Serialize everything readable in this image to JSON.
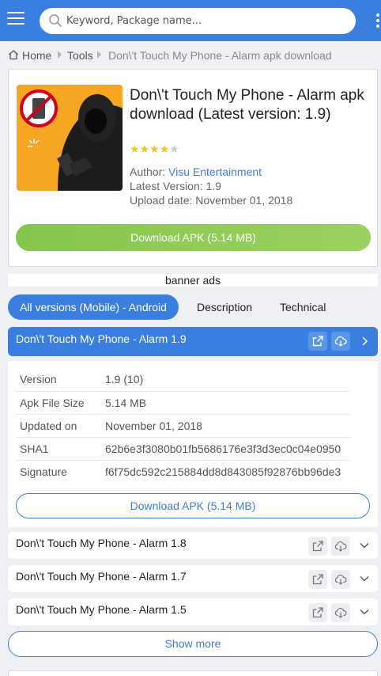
{
  "header": {
    "search_placeholder": "Keyword, Package name...",
    "accent": "#3a7ee0"
  },
  "breadcrumb": {
    "home": "Home",
    "category": "Tools",
    "current": "Don\\'t Touch My Phone - Alarm apk download"
  },
  "app": {
    "title": "Don\\'t Touch My Phone - Alarm apk download (Latest version: 1.9)",
    "rating": 4,
    "rating_max": 5,
    "author_label": "Author:",
    "author": "Visu Entertainment",
    "latest_version": "Latest Version: 1.9",
    "upload_date": "Upload date: November 01, 2018",
    "download_label": "Download APK (5.14 MB)"
  },
  "banner": "banner ads",
  "tabs": [
    "All versions (Mobile) - Android",
    "Description",
    "Technical"
  ],
  "expanded_version": {
    "title": "Don\\'t Touch My Phone - Alarm 1.9",
    "rows": [
      {
        "key": "Version",
        "value": "1.9 (10)"
      },
      {
        "key": "Apk File Size",
        "value": "5.14 MB"
      },
      {
        "key": "Updated on",
        "value": "November 01, 2018"
      },
      {
        "key": "SHA1",
        "value": "62b6e3f3080b01fb5686176e3f3d3ec0c04e0950"
      },
      {
        "key": "Signature",
        "value": "f6f75dc592c215884dd8d843085f92876bb96de3"
      }
    ],
    "download_label": "Download APK (5.14 MB)"
  },
  "other_versions": [
    {
      "title": "Don\\'t Touch My Phone - Alarm 1.8"
    },
    {
      "title": "Don\\'t Touch My Phone - Alarm 1.7"
    },
    {
      "title": "Don\\'t Touch My Phone - Alarm 1.5"
    }
  ],
  "show_more": "Show more"
}
